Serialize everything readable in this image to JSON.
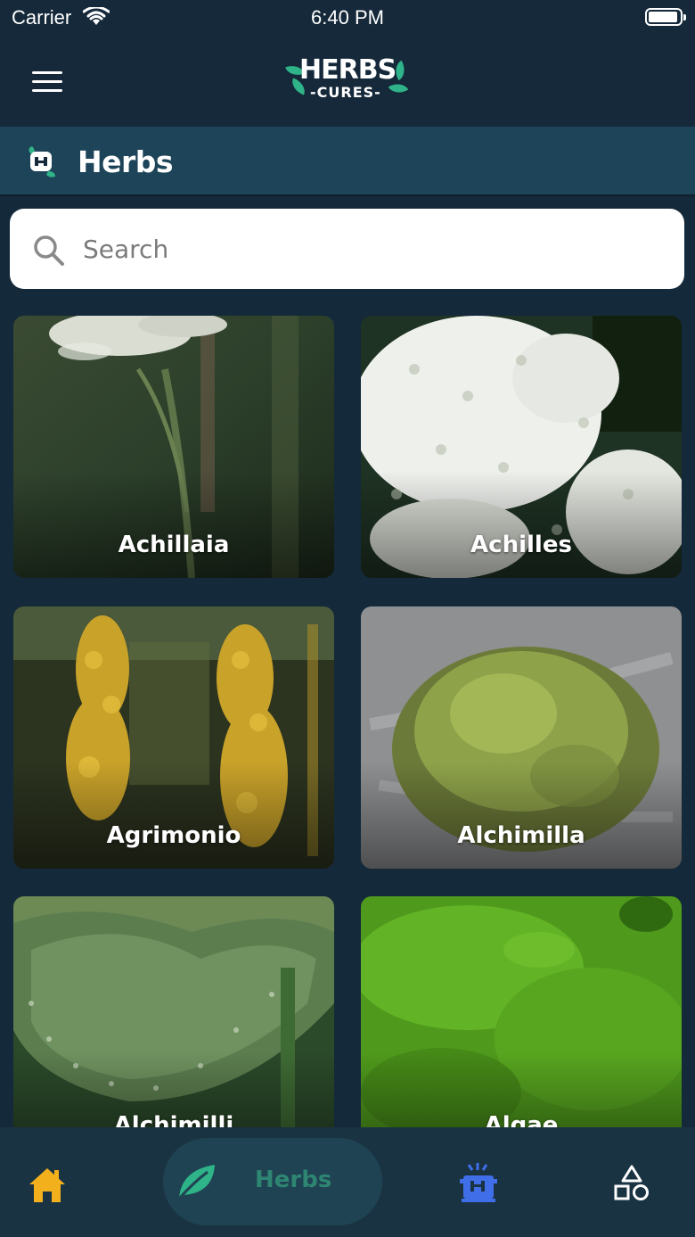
{
  "status_bar": {
    "carrier": "Carrier",
    "time": "6:40 PM"
  },
  "app": {
    "logo_main": "HERBS",
    "logo_sub": "-CURES-"
  },
  "section": {
    "title": "Herbs"
  },
  "search": {
    "placeholder": "Search",
    "value": ""
  },
  "herbs": [
    {
      "name": "Achillaia"
    },
    {
      "name": "Achilles"
    },
    {
      "name": "Agrimonio"
    },
    {
      "name": "Alchimilla"
    },
    {
      "name": "Alchimilli"
    },
    {
      "name": "Algae"
    }
  ],
  "tab_bar": {
    "active_label": "Herbs",
    "home_icon_color": "#f2b01c",
    "herbs_icon_color": "#2fb388",
    "recipes_icon_color": "#3f6ee8",
    "shapes_icon_color": "#ffffff"
  },
  "icons": {
    "menu": "hamburger-icon",
    "section": "herbs-cures-icon",
    "search": "search-icon",
    "home": "home-icon",
    "herbs": "leaf-icon",
    "recipes": "cooking-pot-icon",
    "shapes": "shapes-icon"
  }
}
